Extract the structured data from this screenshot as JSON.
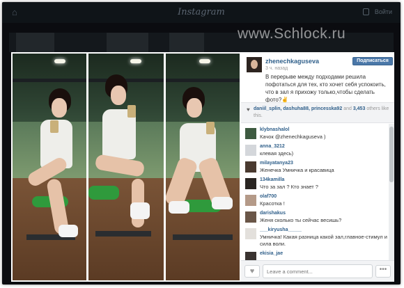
{
  "topbar": {
    "brand": "Instagram",
    "login": "Войти"
  },
  "watermark": "www.Schlock.ru",
  "post": {
    "username": "zhenechkaguseva",
    "time_ago": "3 ч. назад",
    "subscribe_label": "Подписаться",
    "caption": "В перерыве между подходами решила пофотаться для тех, кто хочет себя успокоить, что в зал я прихожу только,чтобы сделать фото?✌",
    "likes_users": "daniil_splin, dashuha88, princesska92",
    "likes_and": "and",
    "likes_count": "3,453",
    "likes_suffix": "others like this."
  },
  "comments": [
    {
      "user": "klybnashalol",
      "text": "Качок @zhenechkaguseva )"
    },
    {
      "user": "anna_3212",
      "text": "клевая здесь)"
    },
    {
      "user": "milayatanya23",
      "text": "Женечка Умничка и красавица"
    },
    {
      "user": "134kamilla",
      "text": "Что за зал ? Кто знает ?"
    },
    {
      "user": "olaf700",
      "text": "Красотка !"
    },
    {
      "user": "darishakus",
      "text": "Женя сколько ты сейчас весишь?"
    },
    {
      "user": "___kiryusha_____",
      "text": "Умничка! Какая разница какой зал,главное-стимул и сила воли."
    },
    {
      "user": "ekisia_jae",
      "text": ""
    }
  ],
  "footer": {
    "comment_placeholder": "Leave a comment...",
    "more_label": "•••"
  }
}
